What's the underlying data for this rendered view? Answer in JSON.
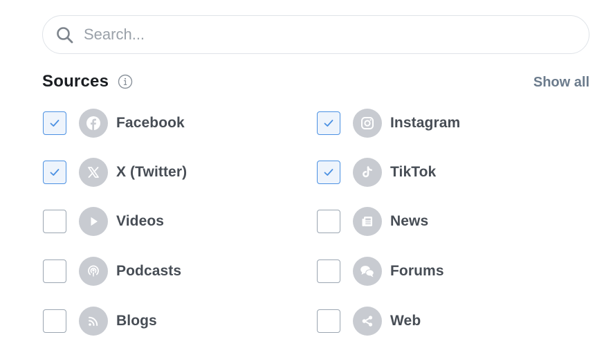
{
  "search": {
    "placeholder": "Search..."
  },
  "sources": {
    "title": "Sources",
    "show_all_label": "Show all",
    "items": [
      {
        "label": "Facebook",
        "checked": true,
        "icon": "facebook-icon"
      },
      {
        "label": "Instagram",
        "checked": true,
        "icon": "instagram-icon"
      },
      {
        "label": "X (Twitter)",
        "checked": true,
        "icon": "x-twitter-icon"
      },
      {
        "label": "TikTok",
        "checked": true,
        "icon": "tiktok-icon"
      },
      {
        "label": "Videos",
        "checked": false,
        "icon": "play-icon"
      },
      {
        "label": "News",
        "checked": false,
        "icon": "newspaper-icon"
      },
      {
        "label": "Podcasts",
        "checked": false,
        "icon": "podcast-icon"
      },
      {
        "label": "Forums",
        "checked": false,
        "icon": "chat-bubbles-icon"
      },
      {
        "label": "Blogs",
        "checked": false,
        "icon": "rss-icon"
      },
      {
        "label": "Web",
        "checked": false,
        "icon": "share-icon"
      }
    ]
  },
  "colors": {
    "checkbox_checked_border": "#4a90e2",
    "checkbox_checked_fill": "#eef4fc",
    "checkmark": "#4a90e2",
    "source_icon_bg": "#c8cbd1",
    "show_all": "#6b7b8c"
  }
}
